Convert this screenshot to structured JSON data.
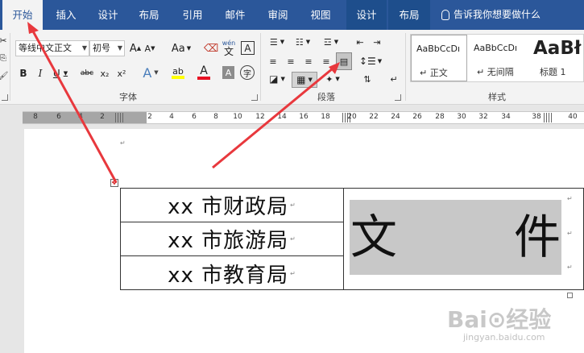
{
  "tabs": [
    {
      "label": "开始",
      "active": true
    },
    {
      "label": "插入"
    },
    {
      "label": "设计"
    },
    {
      "label": "布局"
    },
    {
      "label": "引用"
    },
    {
      "label": "邮件"
    },
    {
      "label": "审阅"
    },
    {
      "label": "视图"
    },
    {
      "label": "设计",
      "contextual": true
    },
    {
      "label": "布局",
      "contextual": true
    }
  ],
  "tell_me": "告诉我你想要做什么",
  "font": {
    "western": "等线",
    "eastasian": "中文正文",
    "size": "初号",
    "grow_label": "A",
    "shrink_label": "A",
    "case_label": "Aa",
    "pinyin_label": "wén",
    "pinyin_char": "文",
    "border_char": "A",
    "bold": "B",
    "italic": "I",
    "underline": "U",
    "strike": "abc",
    "sub": "x₂",
    "sup": "x²",
    "effect": "A",
    "highlight": "ab",
    "color": "A",
    "shade": "A",
    "enclose": "字",
    "group_label": "字体"
  },
  "paragraph": {
    "group_label": "段落"
  },
  "styles": {
    "items": [
      {
        "sample": "AaBbCcDı",
        "name": "正文"
      },
      {
        "sample": "AaBbCcDı",
        "name": "无间隔"
      },
      {
        "sample": "AaBł",
        "name": "标题 1"
      }
    ],
    "group_label": "样式"
  },
  "ruler": {
    "left_numbers": [
      "8",
      "6",
      "4",
      "2"
    ],
    "numbers": [
      "2",
      "4",
      "6",
      "8",
      "10",
      "12",
      "14",
      "16",
      "18",
      "20",
      "22",
      "24",
      "26",
      "28",
      "30",
      "32",
      "34",
      "38",
      "40"
    ]
  },
  "document": {
    "rows": [
      "xx 市财政局",
      "xx 市旅游局",
      "xx 市教育局"
    ],
    "merged_left": "文",
    "merged_right": "件"
  },
  "watermark": {
    "brand": "Bai⊙经验",
    "url": "jingyan.baidu.com"
  },
  "colors": {
    "tab_bar": "#2b579a",
    "ribbon": "#f3f3f3",
    "cell_shading": "#c8c8c8",
    "arrow": "#e8383d"
  }
}
